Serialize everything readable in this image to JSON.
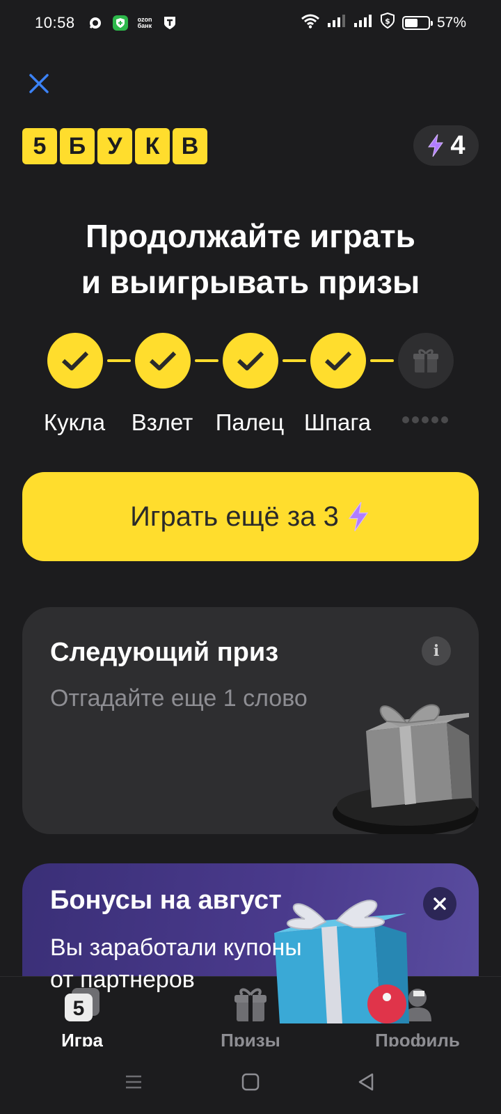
{
  "status_bar": {
    "time": "10:58",
    "battery_percent": "57%",
    "battery_level": 0.57,
    "left_icons": [
      "chat-icon",
      "shield-plus-icon",
      "ozon-bank-icon",
      "t-bank-icon"
    ],
    "right_icons": [
      "wifi-icon",
      "signal-icon",
      "signal-icon",
      "vpn-shield-icon",
      "battery-icon"
    ],
    "ozon_line1": "ozon",
    "ozon_line2": "банк"
  },
  "header": {
    "close_icon": "close-icon",
    "logo_letters": [
      "5",
      "Б",
      "У",
      "К",
      "В"
    ],
    "energy": {
      "icon": "lightning-icon",
      "value": "4"
    }
  },
  "headline": {
    "line1": "Продолжайте играть",
    "line2": "и выигрывать призы"
  },
  "progress": {
    "steps": [
      {
        "label": "Кукла",
        "state": "done"
      },
      {
        "label": "Взлет",
        "state": "done"
      },
      {
        "label": "Палец",
        "state": "done"
      },
      {
        "label": "Шпага",
        "state": "done"
      },
      {
        "label": "",
        "state": "locked"
      }
    ]
  },
  "play_button": {
    "label": "Играть ещё за 3",
    "icon": "lightning-icon"
  },
  "next_prize": {
    "title": "Следующий приз",
    "subtitle": "Отгадайте еще 1 слово",
    "info_icon": "i"
  },
  "bonus_card": {
    "title": "Бонусы на август",
    "subtitle": "Вы заработали купоны от партнеров"
  },
  "bottom_nav": {
    "items": [
      {
        "label": "Игра",
        "icon": "game-icon",
        "active": true
      },
      {
        "label": "Призы",
        "icon": "gift-icon",
        "active": false
      },
      {
        "label": "Профиль",
        "icon": "profile-icon",
        "active": false
      }
    ]
  },
  "colors": {
    "background": "#1c1c1e",
    "accent_yellow": "#ffdd2d",
    "card": "#2e2e30",
    "bonus_purple": "#4a3a8c",
    "close_blue": "#3b82f6"
  }
}
